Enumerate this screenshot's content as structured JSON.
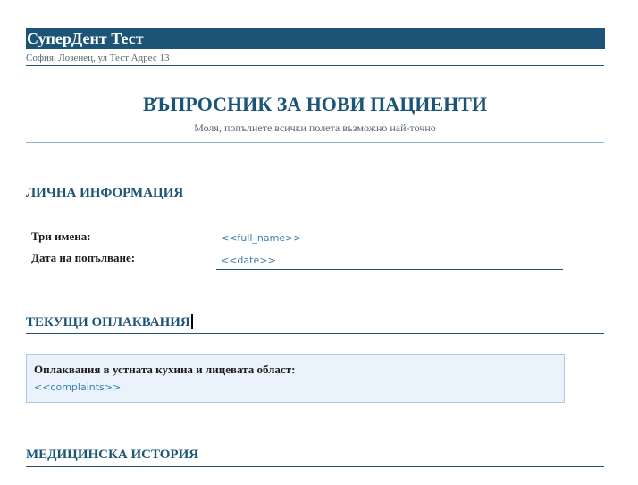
{
  "header": {
    "clinic_name": "СуперДент Тест",
    "clinic_address": "София, Лозенец, ул Тест Адрес 13"
  },
  "form": {
    "title": "ВЪПРОСНИК ЗА НОВИ ПАЦИЕНТИ",
    "subtitle": "Моля, попълнете всички полета възможно най-точно"
  },
  "sections": {
    "personal": {
      "heading": "ЛИЧНА ИНФОРМАЦИЯ",
      "fields": [
        {
          "label": "Три имена:",
          "value": "<<full_name>>"
        },
        {
          "label": "Дата на попълване:",
          "value": "<<date>>"
        }
      ]
    },
    "complaints": {
      "heading": "ТЕКУЩИ ОПЛАКВАНИЯ",
      "label": "Оплаквания в устната кухина и лицевата област:",
      "value": "<<complaints>>"
    },
    "medical_history": {
      "heading": "МЕДИЦИНСКА ИСТОРИЯ"
    }
  },
  "colors": {
    "accent": "#1c5478",
    "placeholder": "#3b7fb3",
    "box_background": "#eaf3fb"
  }
}
